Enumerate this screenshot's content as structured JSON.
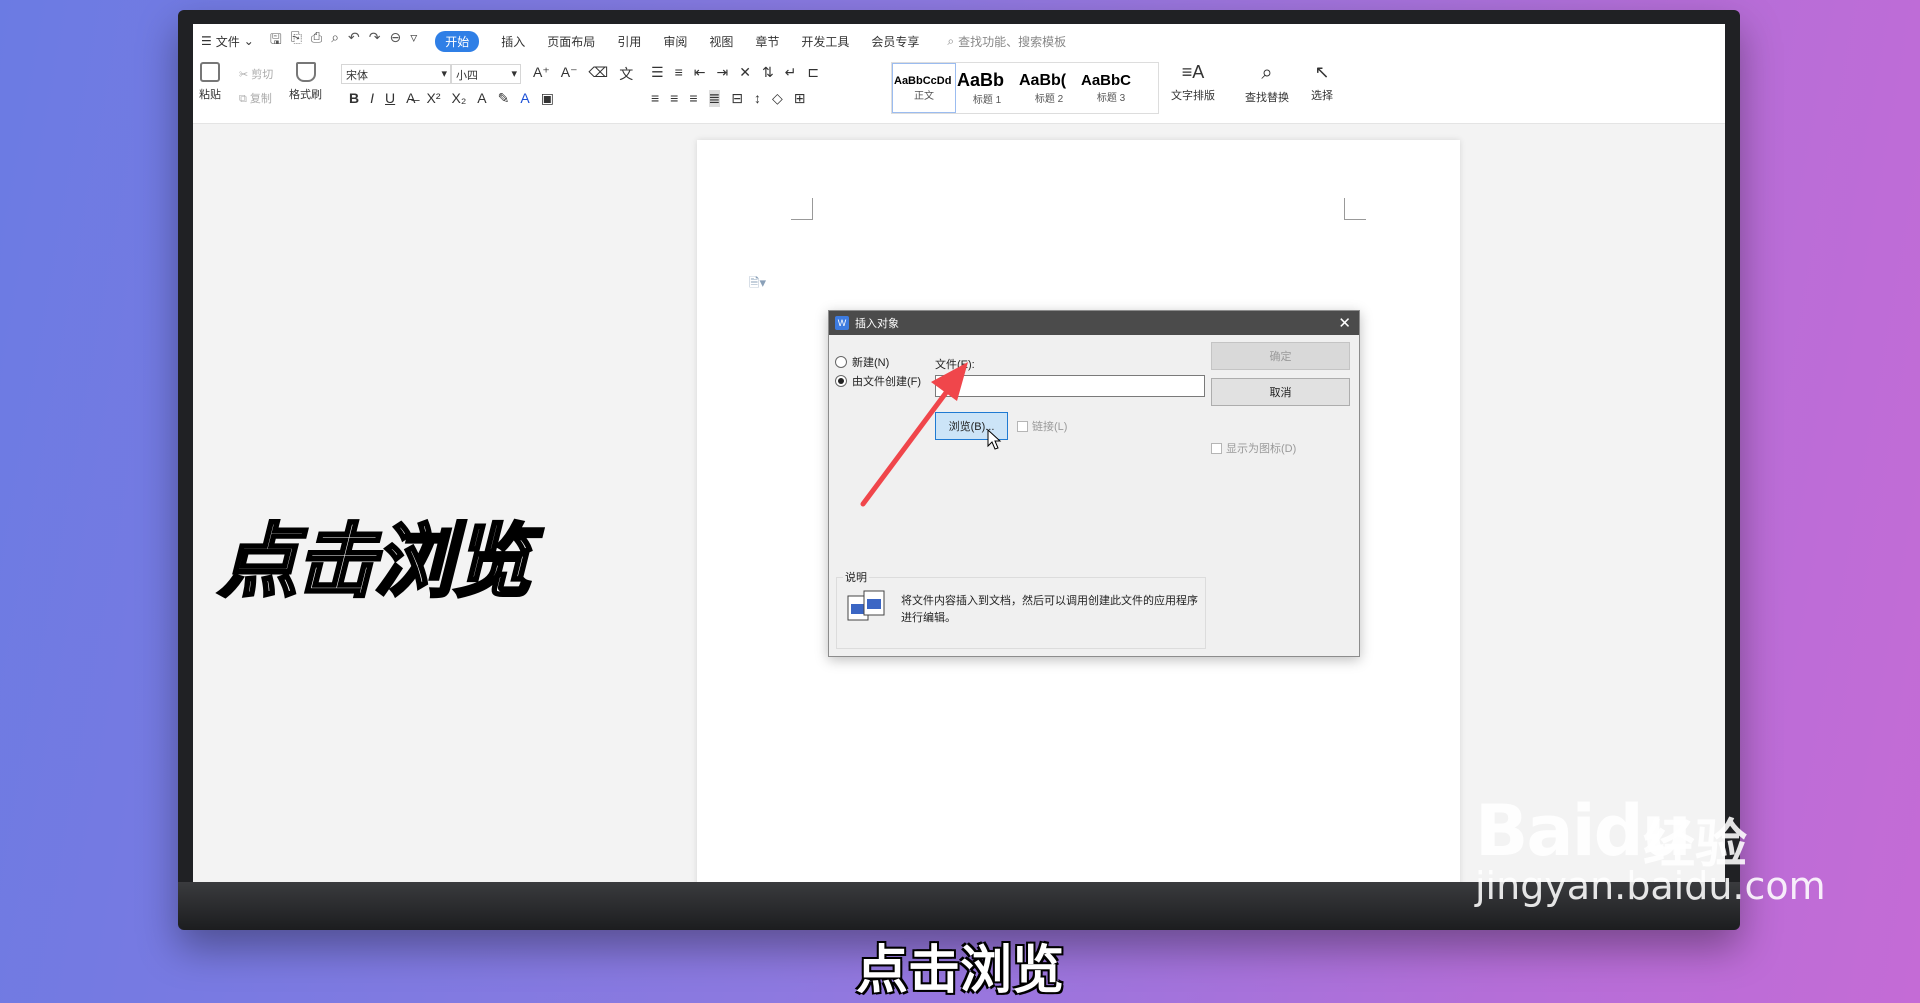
{
  "ribbon": {
    "file_menu": "文件",
    "tabs": [
      "开始",
      "插入",
      "页面布局",
      "引用",
      "审阅",
      "视图",
      "章节",
      "开发工具",
      "会员专享"
    ],
    "search_text": "查找功能、搜索模板",
    "clipboard": {
      "paste": "粘贴",
      "cut": "剪切",
      "copy": "复制",
      "format_painter": "格式刷"
    },
    "font_name": "宋体",
    "font_size": "小四",
    "styles": [
      {
        "preview": "AaBbCcDd",
        "name": "正文"
      },
      {
        "preview": "AaBb",
        "name": "标题 1"
      },
      {
        "preview": "AaBb(",
        "name": "标题 2"
      },
      {
        "preview": "AaBbC",
        "name": "标题 3"
      }
    ],
    "text_layout": "文字排版",
    "find_replace": "查找替换",
    "select": "选择"
  },
  "dialog": {
    "title": "插入对象",
    "radio_new": "新建(N)",
    "radio_from_file": "由文件创建(F)",
    "file_label": "文件(E):",
    "file_value": "",
    "browse_button": "浏览(B)...",
    "link_label": "链接(L)",
    "ok_button": "确定",
    "cancel_button": "取消",
    "display_as_icon": "显示为图标(D)",
    "desc_label": "说明",
    "desc_text": "将文件内容插入到文档，然后可以调用创建此文件的应用程序进行编辑。"
  },
  "overlay_text": "点击浏览",
  "caption": "点击浏览",
  "watermark": {
    "brand": "Baidu",
    "product": "经验",
    "url": "jingyan.baidu.com"
  },
  "colors": {
    "accent": "#2f7fe6",
    "arrow": "#f0464b"
  }
}
